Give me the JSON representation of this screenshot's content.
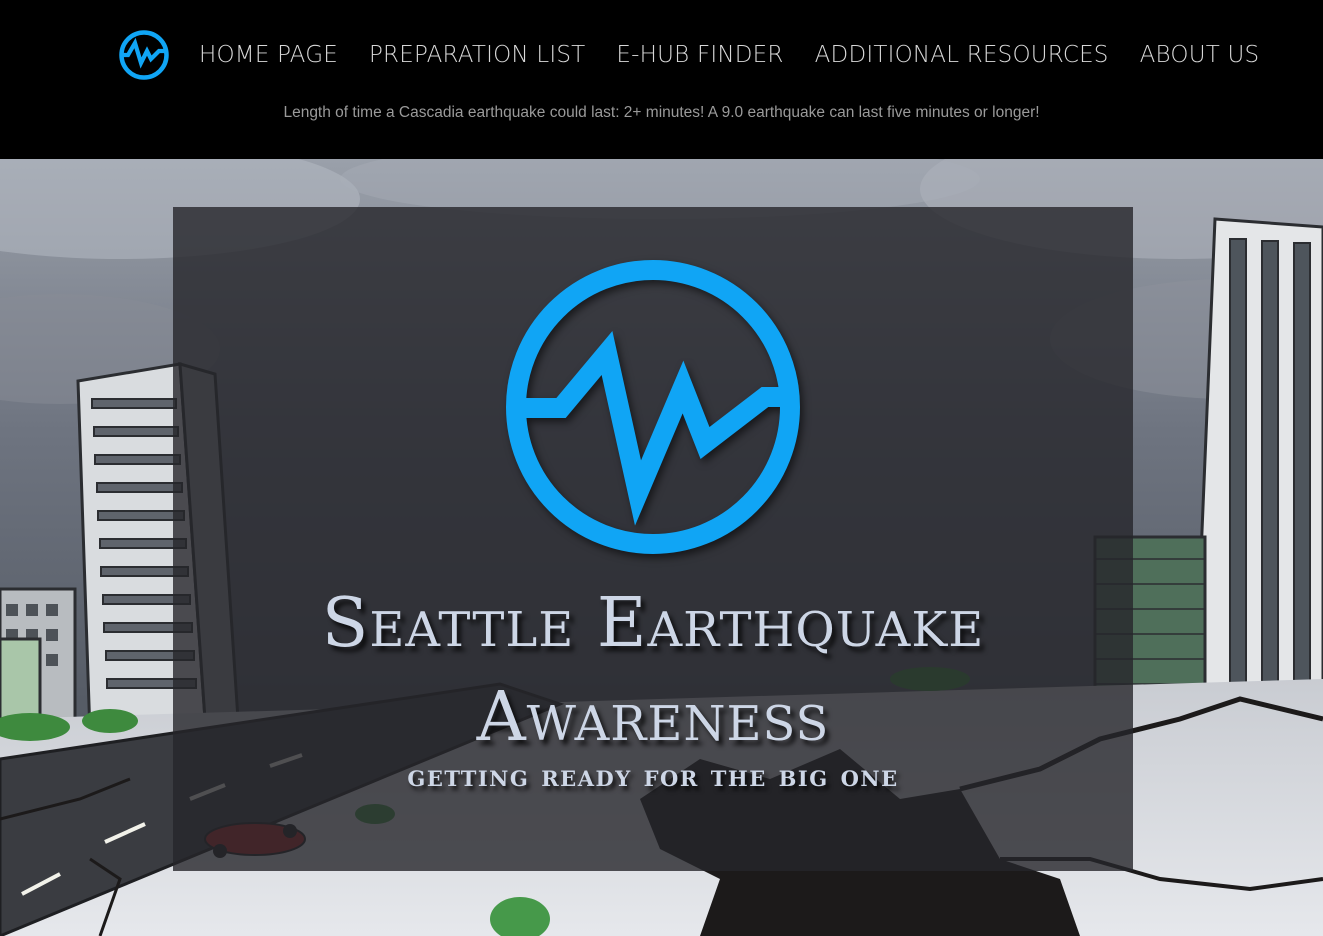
{
  "nav": {
    "logo_icon": "seismic-wave-circle-icon",
    "links": [
      {
        "label": "HOME PAGE"
      },
      {
        "label": "PREPARATION LIST"
      },
      {
        "label": "E-HUB FINDER"
      },
      {
        "label": "ADDITIONAL RESOURCES"
      },
      {
        "label": "ABOUT US"
      }
    ]
  },
  "fact_banner": {
    "text": "Length of time a Cascadia earthquake could last: 2+ minutes! A 9.0 earthquake can last five minutes or longer!"
  },
  "hero": {
    "background": "cartoon-earthquake-city-illustration",
    "logo_icon": "seismic-wave-circle-icon",
    "title": "Seattle Earthquake Awareness",
    "subtitle": "getting ready for the big one"
  },
  "colors": {
    "accent": "#10a5f5",
    "header_bg": "#000000",
    "nav_text": "#d8d8d8",
    "fact_text": "#9a9a9a",
    "hero_text": "#cdd6e6",
    "panel_bg": "#26262a"
  }
}
